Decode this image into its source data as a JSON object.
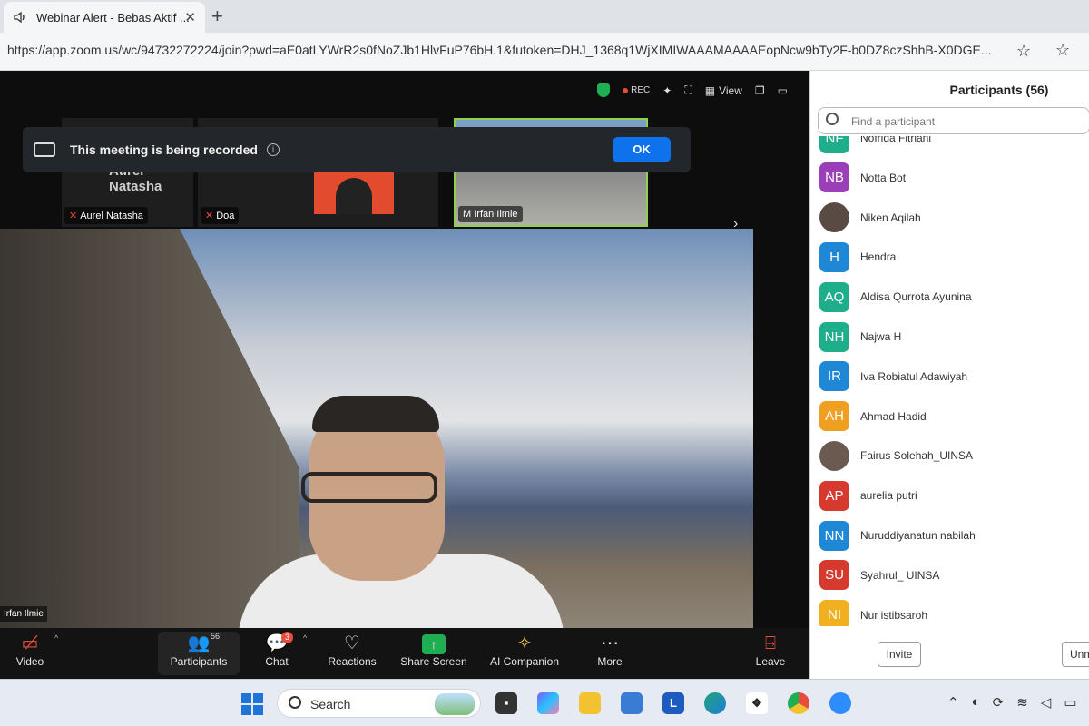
{
  "browser": {
    "tab_title": "Webinar Alert - Bebas Aktif ...",
    "tab_close": "✕",
    "new_tab": "+",
    "url": "https://app.zoom.us/wc/94732272224/join?pwd=aE0atLYWrR2s0fNoZJb1HlvFuP76bH.1&futoken=DHJ_1368q1WjXIMIWAAAMAAAAEopNcw9bTy2F-b0DZ8czShhB-X0DGE..."
  },
  "meeting": {
    "rec_label": "REC",
    "view_label": "View",
    "banner_text": "This meeting is being recorded",
    "banner_info": "i",
    "ok_label": "OK",
    "thumbs": [
      {
        "name": "Aurel Natasha",
        "big_name": "Aurel Natasha"
      },
      {
        "name": "Doa"
      },
      {
        "name": "M Irfan Ilmie"
      }
    ],
    "main_speaker_name": "Irfan Ilmie",
    "thumb_next": "›"
  },
  "toolbar": {
    "video": "Video",
    "participants": "Participants",
    "participants_count": "56",
    "chat": "Chat",
    "chat_badge": "3",
    "reactions": "Reactions",
    "share_screen": "Share Screen",
    "ai_companion": "AI Companion",
    "more": "More",
    "leave": "Leave"
  },
  "panel": {
    "title": "Participants (56)",
    "search_placeholder": "Find a participant",
    "participants": [
      {
        "initials": "NF",
        "name": "Nofrida Fitriani",
        "color": "#1fae8c"
      },
      {
        "initials": "NB",
        "name": "Notta Bot",
        "color": "#9b3fb8"
      },
      {
        "initials": "",
        "name": "Niken Aqilah",
        "color": "#5a4a44"
      },
      {
        "initials": "H",
        "name": "Hendra",
        "color": "#1e88d6"
      },
      {
        "initials": "AQ",
        "name": "Aldisa Qurrota Ayunina",
        "color": "#1fae8c"
      },
      {
        "initials": "NH",
        "name": "Najwa H",
        "color": "#1fae8c"
      },
      {
        "initials": "IR",
        "name": "Iva Robiatul Adawiyah",
        "color": "#1e88d6"
      },
      {
        "initials": "AH",
        "name": "Ahmad Hadid",
        "color": "#f0a020"
      },
      {
        "initials": "",
        "name": "Fairus Solehah_UINSA",
        "color": "#6b5a50"
      },
      {
        "initials": "AP",
        "name": "aurelia putri",
        "color": "#d63a2f"
      },
      {
        "initials": "NN",
        "name": "Nuruddiyanatun nabilah",
        "color": "#1e88d6"
      },
      {
        "initials": "SU",
        "name": "Syahrul_ UINSA",
        "color": "#d63a2f"
      },
      {
        "initials": "NI",
        "name": "Nur istibsaroh",
        "color": "#f0b020"
      }
    ],
    "invite_label": "Invite",
    "unmute_label": "Unmute Me"
  },
  "taskbar": {
    "search_label": "Search"
  }
}
